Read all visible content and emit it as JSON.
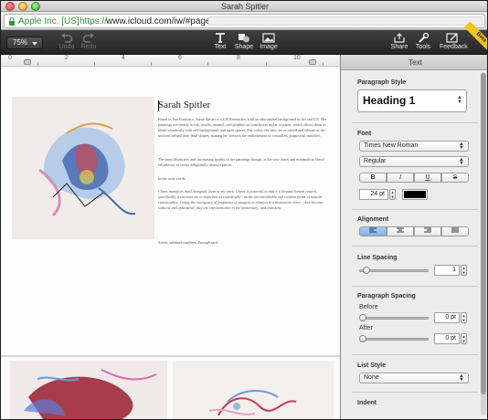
{
  "window": {
    "title": "Sarah Spitler"
  },
  "address": {
    "cert": "Apple Inc. [US]",
    "protocol": "https://",
    "host": "www.icloud.com/iw/#pages/"
  },
  "toolbar": {
    "zoom": "75%",
    "undo": "Undo",
    "redo": "Redo",
    "text": "Text",
    "shape": "Shape",
    "image": "Image",
    "share": "Share",
    "tools": "Tools",
    "feedback": "Feedback",
    "badge": "Beta"
  },
  "ruler": {
    "labels": [
      "0",
      "2",
      "4",
      "6",
      "8",
      "10"
    ]
  },
  "document": {
    "title": "Sarah Spitler",
    "paragraphs": [
      "Based in San Francisco, Sarah Spitler is a UX Researcher with an educational background in Art and UX. Her paintings are mostly in ink, acrylic, enamel, and graphite on translucent mylar or paper, which allows them to blend seamlessly with self-backgrounds and open spaces. The colors she uses are as varied and vibrant as the motions behind their final shapes, making her artwork the embodiment of controlled, purposeful mischief.",
      "The most distinctive and fascinating quality of her paintings though, is the way chaos and minimalism blend effortlessly to create delightfully abstract pieces.",
      "In her own words:",
      "Chaos manifests itself alongside form in my work. Chaos is powerful in that it is beyond human control, specifically, it interests me to depiction as catastrophe - as the uncontrollable and random forms of natural catastrophes. I enjoy the emergence of fragments of imagery in relation to a destructive force - they become reduced and ephemeral, they are representative of the momentary, and transient.",
      "Sweet, subdued mayhem. Enough said."
    ]
  },
  "panel": {
    "header": "Text",
    "paragraph_style_label": "Paragraph Style",
    "paragraph_style": "Heading 1",
    "font_label": "Font",
    "font_family": "Times New Roman",
    "font_weight": "Regular",
    "format_buttons": [
      "B",
      "I",
      "U",
      "S"
    ],
    "font_size": "24 pt",
    "font_color": "#000000",
    "alignment_label": "Alignment",
    "line_spacing_label": "Line Spacing",
    "line_spacing": "1",
    "paragraph_spacing_label": "Paragraph Spacing",
    "before_label": "Before",
    "before_value": "0 pt",
    "after_label": "After",
    "after_value": "0 pt",
    "list_style_label": "List Style",
    "list_style": "None",
    "indent_label": "Indent"
  }
}
